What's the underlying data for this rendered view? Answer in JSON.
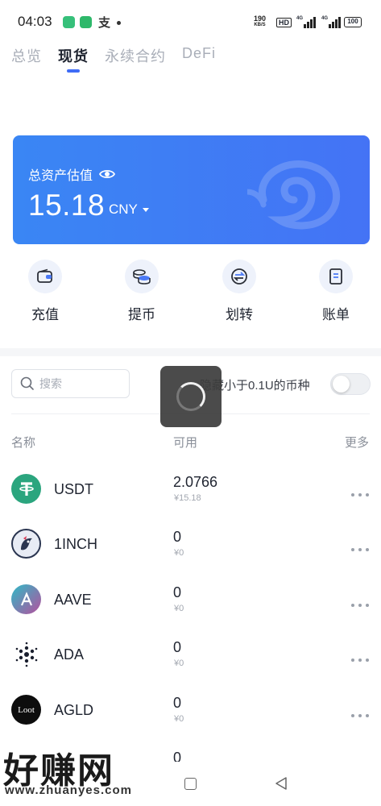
{
  "status_bar": {
    "time": "04:03",
    "pay_glyph": "支",
    "speed_value": "190",
    "speed_unit": "KB/S",
    "hd_label": "HD",
    "sig1_label": "4G",
    "sig2_label": "4G",
    "battery": "100"
  },
  "tabs": [
    {
      "label": "总览"
    },
    {
      "label": "现货"
    },
    {
      "label": "永续合约"
    },
    {
      "label": "DeFi"
    }
  ],
  "asset_card": {
    "label": "总资产估值",
    "value": "15.18",
    "currency": "CNY",
    "colors": {
      "start": "#3a86f4",
      "end": "#4473f5"
    }
  },
  "actions": [
    {
      "label": "充值",
      "icon": "wallet-icon"
    },
    {
      "label": "提币",
      "icon": "coins-icon"
    },
    {
      "label": "划转",
      "icon": "transfer-icon"
    },
    {
      "label": "账单",
      "icon": "bill-icon"
    }
  ],
  "filter": {
    "search_placeholder": "搜索",
    "hide_small_label": "隐藏小于0.1U的币种",
    "hide_small_enabled": false
  },
  "table": {
    "headers": {
      "name": "名称",
      "available": "可用",
      "more": "更多"
    },
    "rows": [
      {
        "name": "USDT",
        "available": "2.0766",
        "cny": "¥15.18",
        "icon": "usdt-icon"
      },
      {
        "name": "1INCH",
        "available": "0",
        "cny": "¥0",
        "icon": "1inch-icon"
      },
      {
        "name": "AAVE",
        "available": "0",
        "cny": "¥0",
        "icon": "aave-icon"
      },
      {
        "name": "ADA",
        "available": "0",
        "cny": "¥0",
        "icon": "ada-icon"
      },
      {
        "name": "AGLD",
        "available": "0",
        "cny": "¥0",
        "icon": "agld-icon",
        "icon_text": "Loot"
      },
      {
        "name": "",
        "available": "0",
        "cny": "",
        "icon": "partial-icon"
      }
    ]
  },
  "watermark": {
    "main": "好赚网",
    "sub": "www.zhuanyes.com"
  },
  "accent_color": "#3f6cf6"
}
